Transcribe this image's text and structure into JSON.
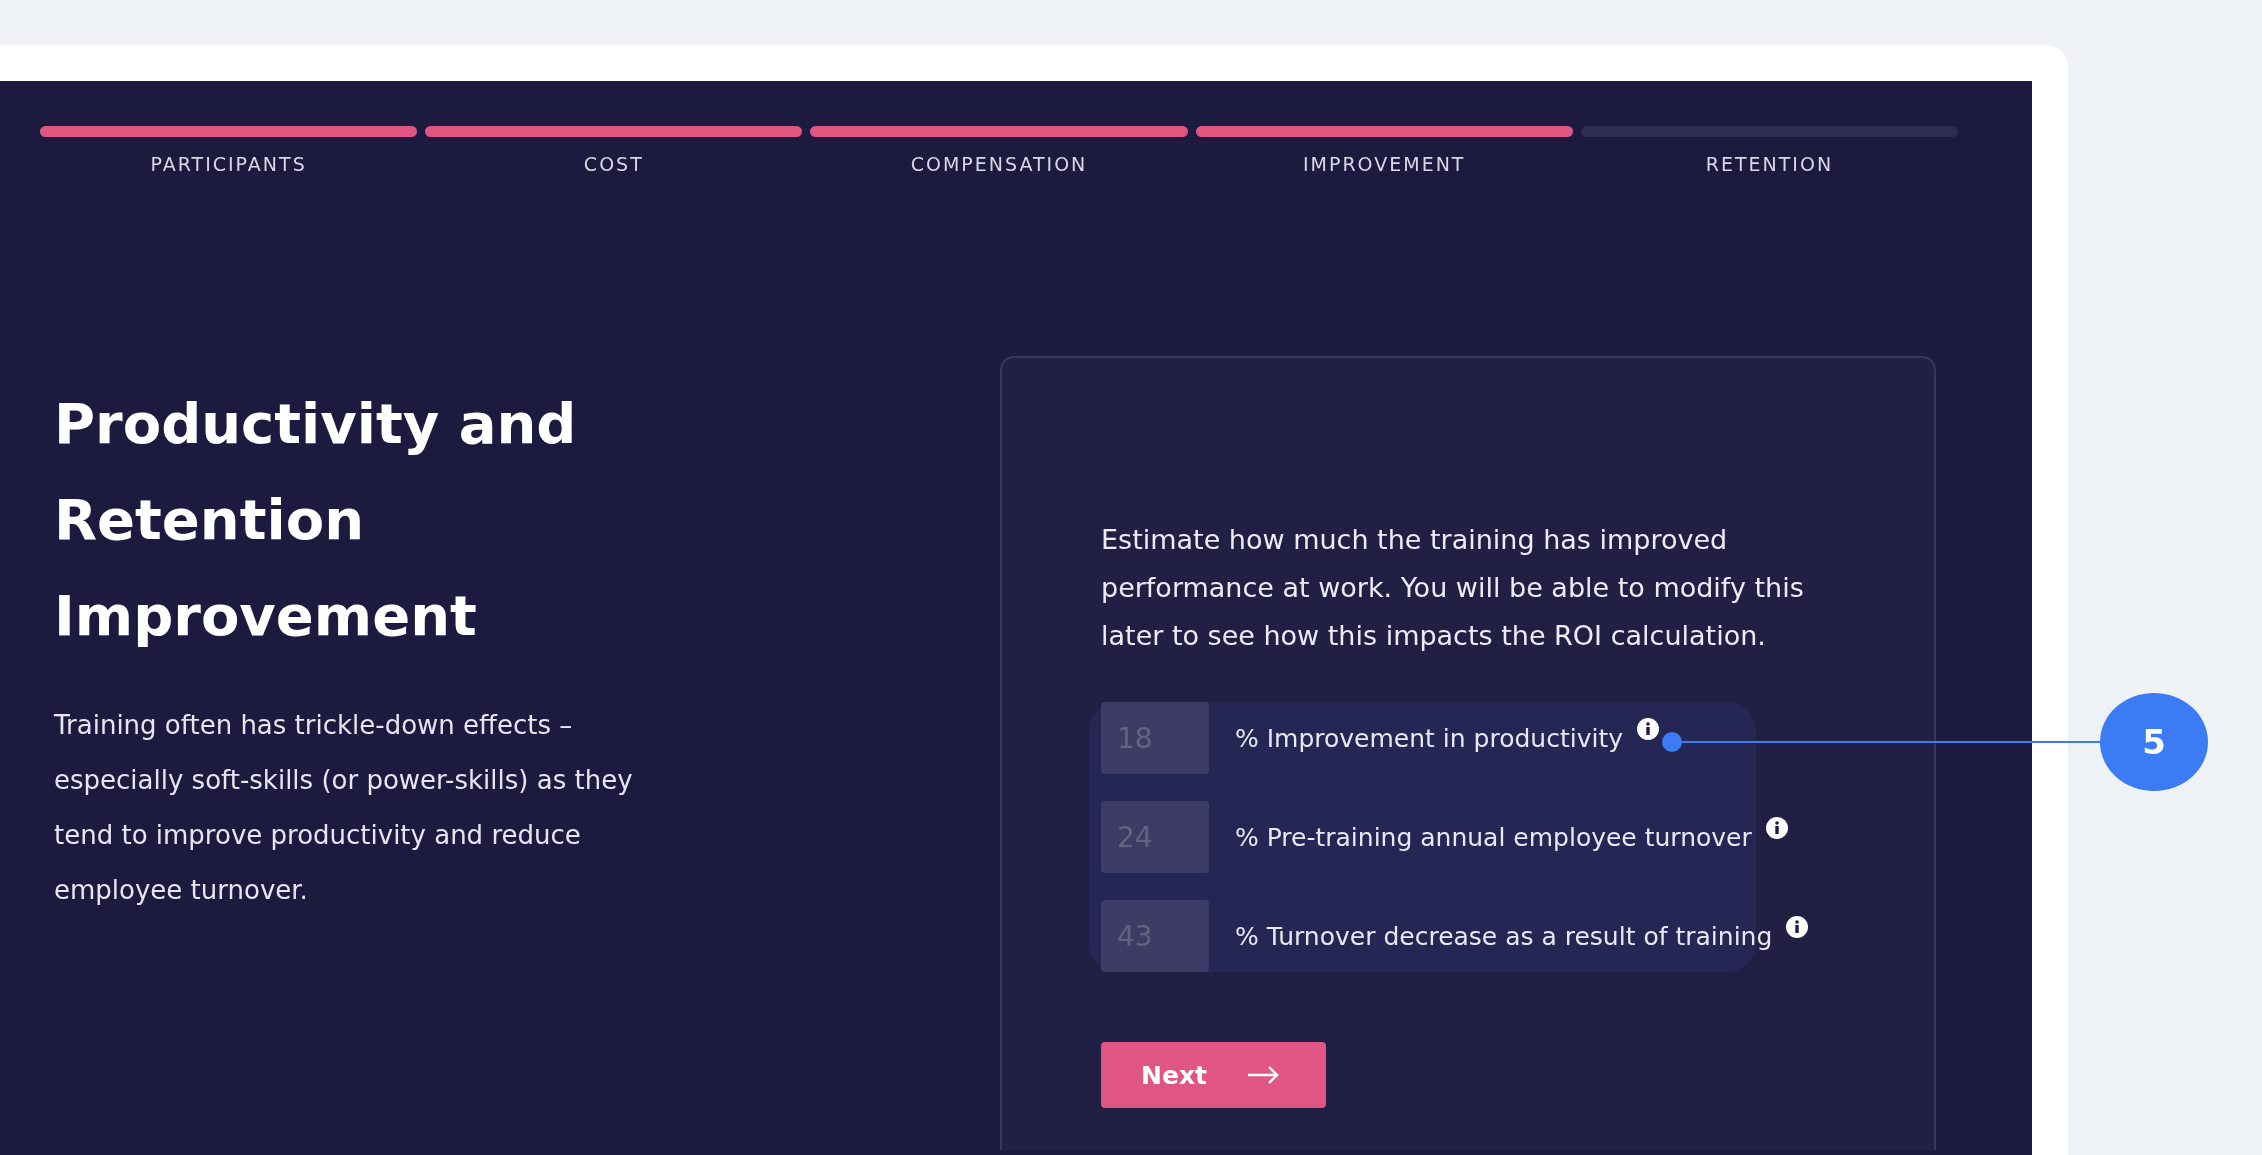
{
  "steps": [
    {
      "label": "PARTICIPANTS",
      "done": true
    },
    {
      "label": "COST",
      "done": true
    },
    {
      "label": "COMPENSATION",
      "done": true
    },
    {
      "label": "IMPROVEMENT",
      "done": true
    },
    {
      "label": "RETENTION",
      "done": false
    }
  ],
  "intro": {
    "title": "Productivity and Retention Improvement",
    "text": "Training often has trickle-down effects – especially soft-skills (or power-skills) as they tend to improve productivity and reduce employee turnover."
  },
  "card": {
    "text": "Estimate how much the training has improved performance at work. You will be able to modify this later to see how this impacts the ROI calculation.",
    "fields": [
      {
        "placeholder": "18",
        "label": "% Improvement in productivity"
      },
      {
        "placeholder": "24",
        "label": "% Pre-training annual employee turnover"
      },
      {
        "placeholder": "43",
        "label": "% Turnover decrease as a result of training"
      }
    ],
    "button": "Next"
  },
  "callout": {
    "number": "5"
  }
}
